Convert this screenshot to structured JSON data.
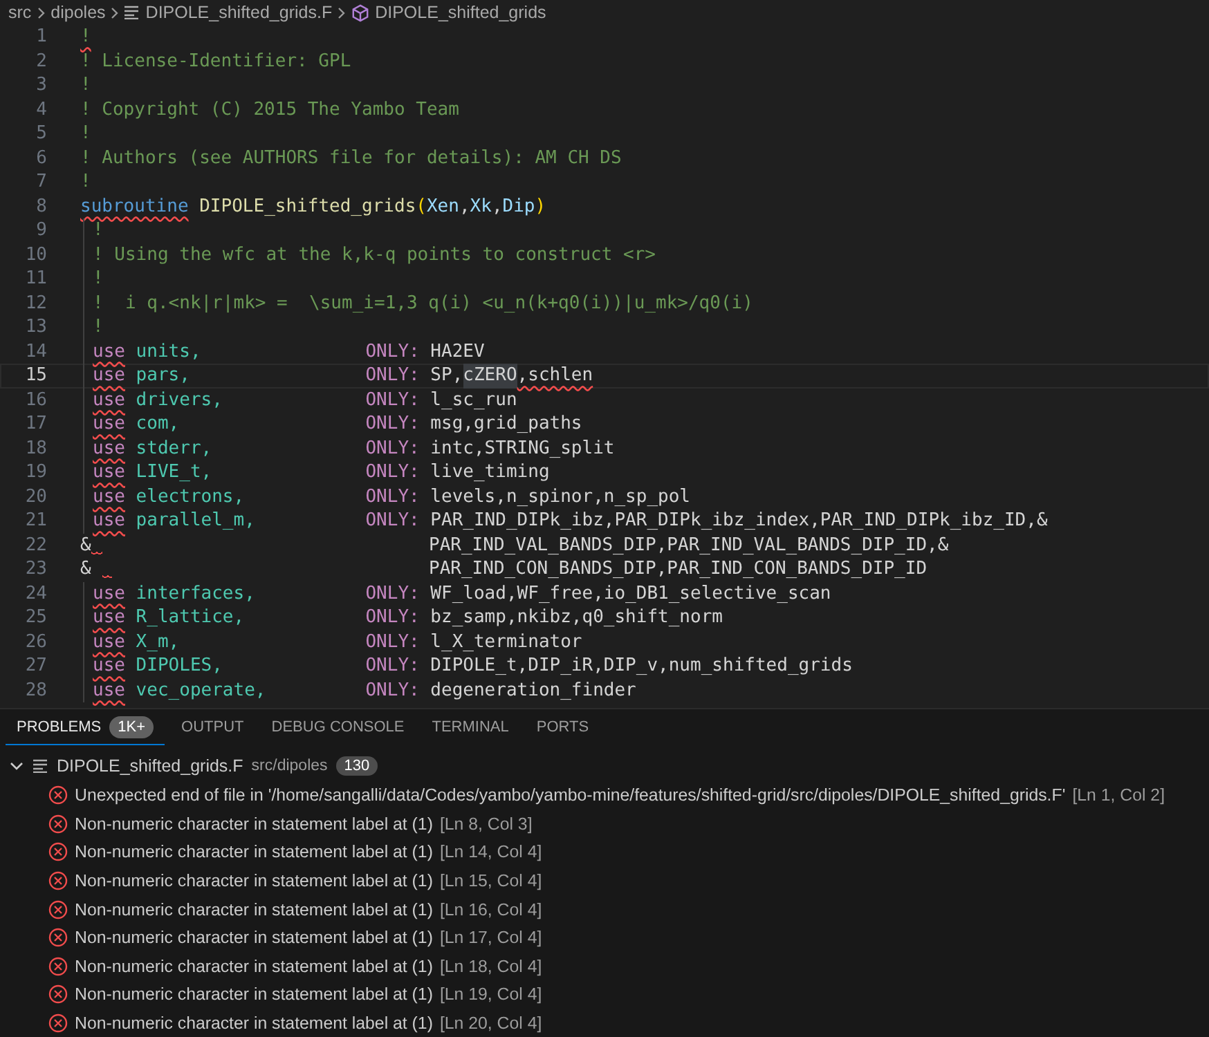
{
  "breadcrumb": [
    {
      "kind": "folder",
      "text": "src"
    },
    {
      "kind": "folder",
      "text": "dipoles"
    },
    {
      "kind": "file",
      "text": "DIPOLE_shifted_grids.F"
    },
    {
      "kind": "symbol",
      "text": "DIPOLE_shifted_grids"
    }
  ],
  "code_lines": [
    {
      "number": "1",
      "current": false,
      "nested": false,
      "left": [
        {
          "kind": "comment",
          "text": "!",
          "error": true
        }
      ]
    },
    {
      "number": "2",
      "current": false,
      "nested": false,
      "left": [
        {
          "kind": "comment",
          "text": "! License-Identifier: GPL",
          "error": false
        }
      ]
    },
    {
      "number": "3",
      "current": false,
      "nested": false,
      "left": [
        {
          "kind": "comment",
          "text": "!",
          "error": false
        }
      ]
    },
    {
      "number": "4",
      "current": false,
      "nested": false,
      "left": [
        {
          "kind": "comment",
          "text": "! Copyright (C) 2015 The Yambo Team",
          "error": false
        }
      ]
    },
    {
      "number": "5",
      "current": false,
      "nested": false,
      "left": [
        {
          "kind": "comment",
          "text": "!",
          "error": false
        }
      ]
    },
    {
      "number": "6",
      "current": false,
      "nested": false,
      "left": [
        {
          "kind": "comment",
          "text": "! Authors (see AUTHORS file for details): AM CH DS",
          "error": false
        }
      ]
    },
    {
      "number": "7",
      "current": false,
      "nested": false,
      "left": [
        {
          "kind": "comment",
          "text": "!",
          "error": false
        }
      ]
    },
    {
      "number": "8",
      "current": false,
      "nested": false,
      "left": [
        {
          "kind": "keyword",
          "text": "subroutine",
          "error": true
        },
        {
          "kind": "function",
          "text": " DIPOLE_shifted_grids",
          "error": false
        },
        {
          "kind": "paren",
          "text": "(",
          "error": false
        },
        {
          "kind": "param",
          "text": "Xen",
          "error": false
        },
        {
          "kind": "plain",
          "text": ",",
          "error": false
        },
        {
          "kind": "param",
          "text": "Xk",
          "error": false
        },
        {
          "kind": "plain",
          "text": ",",
          "error": false
        },
        {
          "kind": "param",
          "text": "Dip",
          "error": false
        },
        {
          "kind": "paren",
          "text": ")",
          "error": false
        }
      ]
    },
    {
      "number": "9",
      "current": false,
      "nested": true,
      "left": [
        {
          "kind": "comment",
          "text": "!",
          "error": false
        }
      ]
    },
    {
      "number": "10",
      "current": false,
      "nested": true,
      "left": [
        {
          "kind": "comment",
          "text": "! Using the wfc at the k,k-q points to construct <r>",
          "error": false
        }
      ]
    },
    {
      "number": "11",
      "current": false,
      "nested": true,
      "left": [
        {
          "kind": "comment",
          "text": "!",
          "error": false
        }
      ]
    },
    {
      "number": "12",
      "current": false,
      "nested": true,
      "left": [
        {
          "kind": "comment",
          "text": "!  i q.<nk|r|mk> =  \\sum_i=1,3 q(i) <u_n(k+q0(i))|u_mk>/q0(i)",
          "error": false
        }
      ]
    },
    {
      "number": "13",
      "current": false,
      "nested": true,
      "left": [
        {
          "kind": "comment",
          "text": "!",
          "error": false
        }
      ]
    },
    {
      "number": "14",
      "current": false,
      "nested": true,
      "left": [
        {
          "kind": "use",
          "text": "use",
          "error": true
        },
        {
          "kind": "module",
          "text": " units,",
          "error": false
        }
      ],
      "only": "ONLY:",
      "right": [
        {
          "kind": "plain",
          "text": "HA2EV",
          "error": false
        }
      ]
    },
    {
      "number": "15",
      "current": true,
      "nested": true,
      "left": [
        {
          "kind": "use",
          "text": "use",
          "error": true
        },
        {
          "kind": "module",
          "text": " pars,",
          "error": false
        }
      ],
      "only": "ONLY:",
      "right": [
        {
          "kind": "plain",
          "text": "SP,",
          "error": false
        },
        {
          "kind": "highlight",
          "text": "cZERO",
          "error": false
        },
        {
          "kind": "plain",
          "text": ",schlen",
          "error": true
        }
      ]
    },
    {
      "number": "16",
      "current": false,
      "nested": true,
      "left": [
        {
          "kind": "use",
          "text": "use",
          "error": true
        },
        {
          "kind": "module",
          "text": " drivers,",
          "error": false
        }
      ],
      "only": "ONLY:",
      "right": [
        {
          "kind": "plain",
          "text": "l_sc_run",
          "error": false
        }
      ]
    },
    {
      "number": "17",
      "current": false,
      "nested": true,
      "left": [
        {
          "kind": "use",
          "text": "use",
          "error": true
        },
        {
          "kind": "module",
          "text": " com,",
          "error": false
        }
      ],
      "only": "ONLY:",
      "right": [
        {
          "kind": "plain",
          "text": "msg,grid_paths",
          "error": false
        }
      ]
    },
    {
      "number": "18",
      "current": false,
      "nested": true,
      "left": [
        {
          "kind": "use",
          "text": "use",
          "error": true
        },
        {
          "kind": "module",
          "text": " stderr,",
          "error": false
        }
      ],
      "only": "ONLY:",
      "right": [
        {
          "kind": "plain",
          "text": "intc,STRING_split",
          "error": false
        }
      ]
    },
    {
      "number": "19",
      "current": false,
      "nested": true,
      "left": [
        {
          "kind": "use",
          "text": "use",
          "error": true
        },
        {
          "kind": "module",
          "text": " LIVE_t,",
          "error": false
        }
      ],
      "only": "ONLY:",
      "right": [
        {
          "kind": "plain",
          "text": "live_timing",
          "error": false
        }
      ]
    },
    {
      "number": "20",
      "current": false,
      "nested": true,
      "left": [
        {
          "kind": "use",
          "text": "use",
          "error": true
        },
        {
          "kind": "module",
          "text": " electrons,",
          "error": false
        }
      ],
      "only": "ONLY:",
      "right": [
        {
          "kind": "plain",
          "text": "levels,n_spinor,n_sp_pol",
          "error": false
        }
      ]
    },
    {
      "number": "21",
      "current": false,
      "nested": true,
      "left": [
        {
          "kind": "use",
          "text": "use",
          "error": true
        },
        {
          "kind": "module",
          "text": " parallel_m,",
          "error": false
        }
      ],
      "only": "ONLY:",
      "right": [
        {
          "kind": "plain",
          "text": "PAR_IND_DIPk_ibz,PAR_DIPk_ibz_index,PAR_IND_DIPk_ibz_ID,&",
          "error": false
        }
      ]
    },
    {
      "number": "22",
      "current": false,
      "nested": false,
      "left": [
        {
          "kind": "continuation",
          "text": "&",
          "error": true
        }
      ],
      "right": [
        {
          "kind": "plain",
          "text": "PAR_IND_VAL_BANDS_DIP,PAR_IND_VAL_BANDS_DIP_ID,&",
          "error": false
        }
      ]
    },
    {
      "number": "23",
      "current": false,
      "nested": false,
      "left": [
        {
          "kind": "continuation",
          "text": "& ",
          "error": true
        }
      ],
      "right": [
        {
          "kind": "plain",
          "text": "PAR_IND_CON_BANDS_DIP,PAR_IND_CON_BANDS_DIP_ID",
          "error": false
        }
      ]
    },
    {
      "number": "24",
      "current": false,
      "nested": true,
      "left": [
        {
          "kind": "use",
          "text": "use",
          "error": true
        },
        {
          "kind": "module",
          "text": " interfaces,",
          "error": false
        }
      ],
      "only": "ONLY:",
      "right": [
        {
          "kind": "plain",
          "text": "WF_load,WF_free,io_DB1_selective_scan",
          "error": false
        }
      ]
    },
    {
      "number": "25",
      "current": false,
      "nested": true,
      "left": [
        {
          "kind": "use",
          "text": "use",
          "error": true
        },
        {
          "kind": "module",
          "text": " R_lattice,",
          "error": false
        }
      ],
      "only": "ONLY:",
      "right": [
        {
          "kind": "plain",
          "text": "bz_samp,nkibz,q0_shift_norm",
          "error": false
        }
      ]
    },
    {
      "number": "26",
      "current": false,
      "nested": true,
      "left": [
        {
          "kind": "use",
          "text": "use",
          "error": true
        },
        {
          "kind": "module",
          "text": " X_m,",
          "error": false
        }
      ],
      "only": "ONLY:",
      "right": [
        {
          "kind": "plain",
          "text": "l_X_terminator",
          "error": false
        }
      ]
    },
    {
      "number": "27",
      "current": false,
      "nested": true,
      "left": [
        {
          "kind": "use",
          "text": "use",
          "error": true
        },
        {
          "kind": "module",
          "text": " DIPOLES,",
          "error": false
        }
      ],
      "only": "ONLY:",
      "right": [
        {
          "kind": "plain",
          "text": "DIPOLE_t,DIP_iR,DIP_v,num_shifted_grids",
          "error": false
        }
      ]
    },
    {
      "number": "28",
      "current": false,
      "nested": true,
      "left": [
        {
          "kind": "use",
          "text": "use",
          "error": true
        },
        {
          "kind": "module",
          "text": " vec_operate,",
          "error": false
        }
      ],
      "only": "ONLY:",
      "right": [
        {
          "kind": "plain",
          "text": "degeneration_finder",
          "error": false
        }
      ]
    }
  ],
  "panel": {
    "tabs": [
      {
        "label": "PROBLEMS",
        "badge": "1K+",
        "selected": true
      },
      {
        "label": "OUTPUT",
        "selected": false
      },
      {
        "label": "DEBUG CONSOLE",
        "selected": false
      },
      {
        "label": "TERMINAL",
        "selected": false
      },
      {
        "label": "PORTS",
        "selected": false
      }
    ],
    "file_group": {
      "name": "DIPOLE_shifted_grids.F",
      "path": "src/dipoles",
      "count": "130",
      "expanded": true
    },
    "problems": [
      {
        "message": "Unexpected end of file in '/home/sangalli/data/Codes/yambo/yambo-mine/features/shifted-grid/src/dipoles/DIPOLE_shifted_grids.F'",
        "location": "[Ln 1, Col 2]"
      },
      {
        "message": "Non-numeric character in statement label at (1)",
        "location": "[Ln 8, Col 3]"
      },
      {
        "message": "Non-numeric character in statement label at (1)",
        "location": "[Ln 14, Col 4]"
      },
      {
        "message": "Non-numeric character in statement label at (1)",
        "location": "[Ln 15, Col 4]"
      },
      {
        "message": "Non-numeric character in statement label at (1)",
        "location": "[Ln 16, Col 4]"
      },
      {
        "message": "Non-numeric character in statement label at (1)",
        "location": "[Ln 17, Col 4]"
      },
      {
        "message": "Non-numeric character in statement label at (1)",
        "location": "[Ln 18, Col 4]"
      },
      {
        "message": "Non-numeric character in statement label at (1)",
        "location": "[Ln 19, Col 4]"
      },
      {
        "message": "Non-numeric character in statement label at (1)",
        "location": "[Ln 20, Col 4]"
      }
    ]
  }
}
